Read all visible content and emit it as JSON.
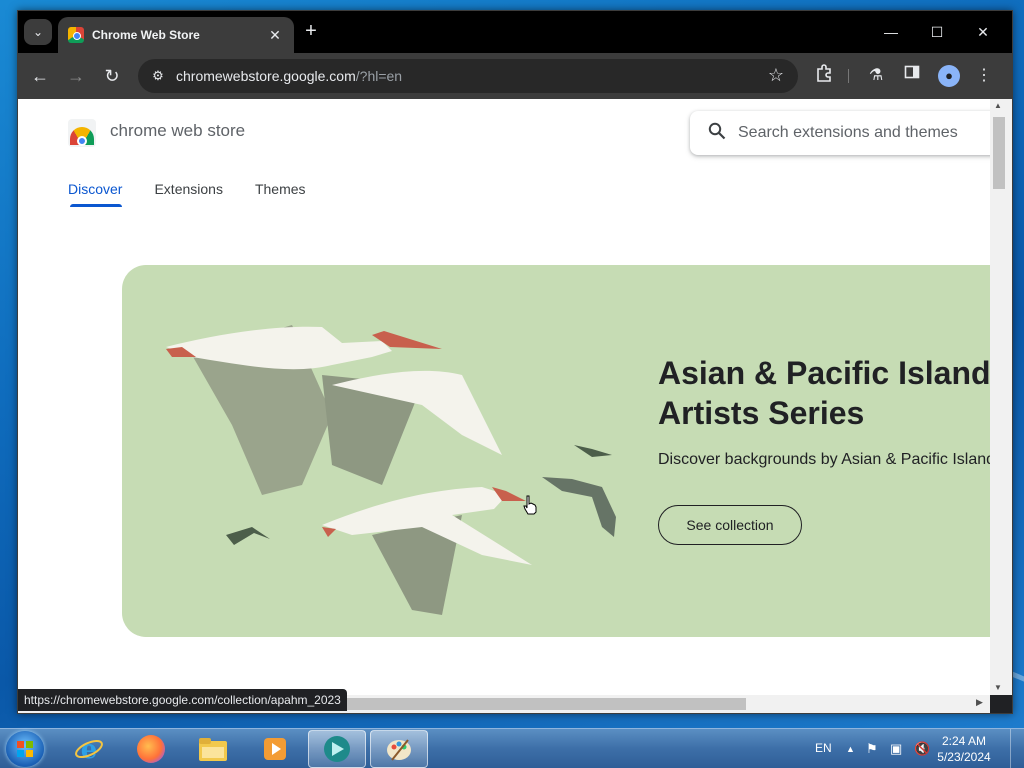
{
  "browser": {
    "tab_title": "Chrome Web Store",
    "url_host": "chromewebstore.google.com",
    "url_rest": "/?hl=en",
    "status_url": "https://chromewebstore.google.com/collection/apahm_2023"
  },
  "store": {
    "name": "chrome web store",
    "search_placeholder": "Search extensions and themes",
    "nav": [
      {
        "label": "Discover"
      },
      {
        "label": "Extensions"
      },
      {
        "label": "Themes"
      }
    ]
  },
  "hero": {
    "title_line1": "Asian & Pacific Islander",
    "title_line2": "Artists Series",
    "subtitle": "Discover backgrounds by Asian & Pacific Islander artists",
    "button_label": "See collection",
    "background_color": "#c6dcb4"
  },
  "taskbar": {
    "language": "EN",
    "time": "2:24 AM",
    "date": "5/23/2024",
    "apps": [
      {
        "name": "internet-explorer-icon"
      },
      {
        "name": "firefox-icon"
      },
      {
        "name": "file-explorer-icon"
      },
      {
        "name": "media-player-icon"
      },
      {
        "name": "chrome-app-icon"
      },
      {
        "name": "paint-icon"
      }
    ]
  }
}
